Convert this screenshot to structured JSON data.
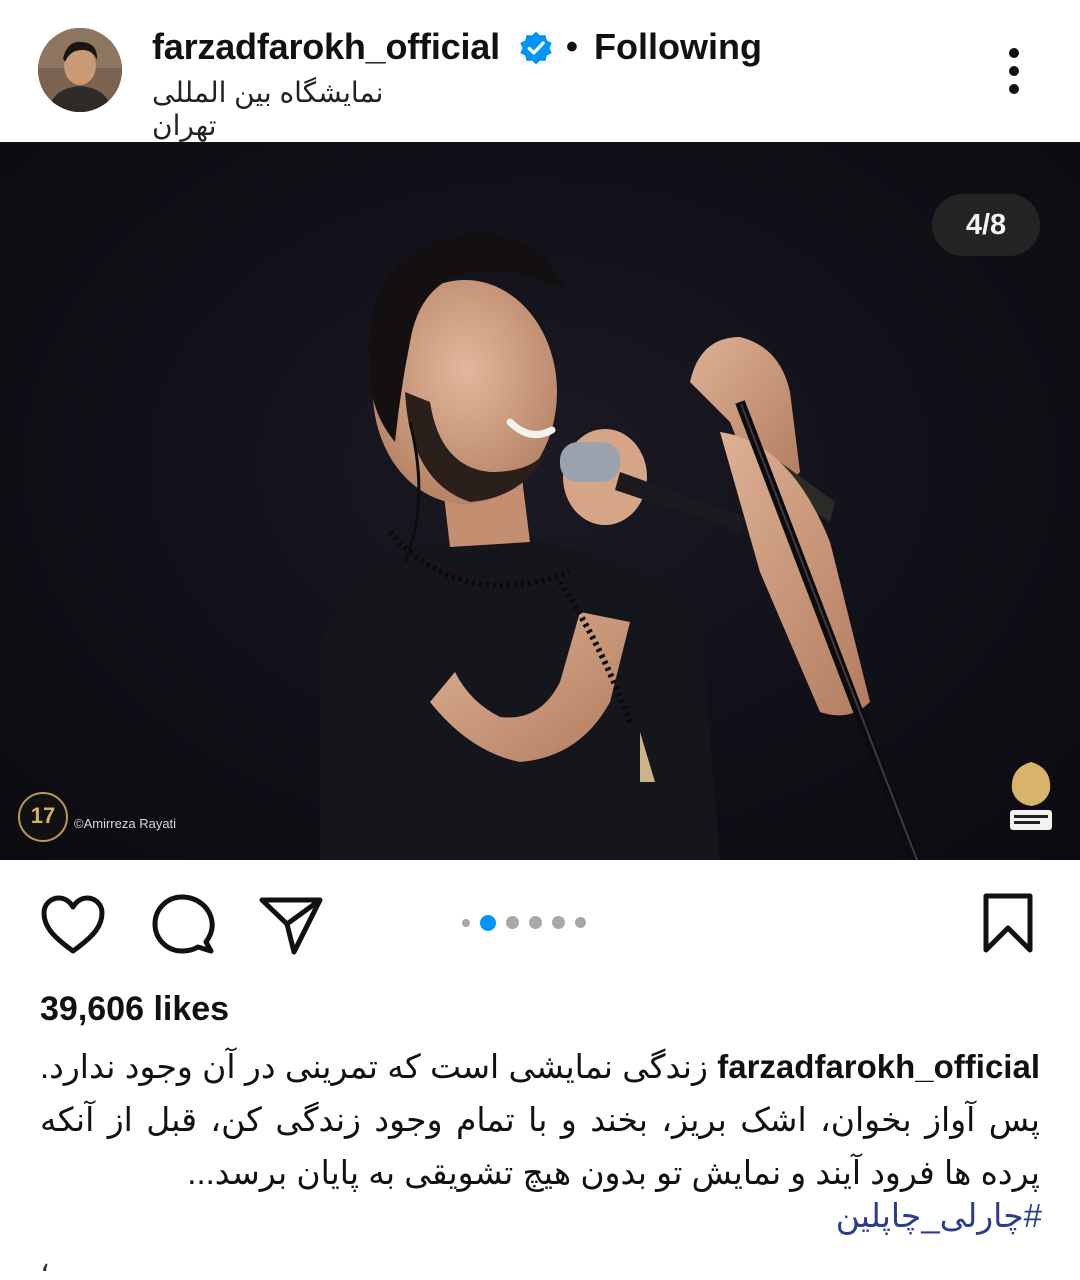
{
  "post": {
    "username": "farzadfarokh_official",
    "separator": "•",
    "follow_status": "Following",
    "location": "نمایشگاه بین المللی تهران"
  },
  "media": {
    "counter": "4/8",
    "photo_credit": "©Amirreza Rayati",
    "badge_text": "17",
    "current_index": 4,
    "total": 8
  },
  "engagement": {
    "likes": "39,606 likes"
  },
  "caption": {
    "username": "farzadfarokh_official",
    "text": "زندگی نمایشی است که تمرینی در آن وجود ندارد. پس آواز بخوان، اشک بریز، بخند و با تمام وجود زندگی کن، قبل از آنکه پرده ها فرود آیند و نمایش تو بدون هیچ تشویقی به پایان برسد...",
    "hashtag": "#چارلی_چاپلین",
    "trailing": "،"
  },
  "icons": {
    "like": "heart-icon",
    "comment": "comment-icon",
    "share": "send-icon",
    "save": "bookmark-icon",
    "more": "more-vertical-icon",
    "verified": "verified-badge-icon"
  },
  "colors": {
    "verified_blue": "#0095f6",
    "active_dot": "#0095f6",
    "hashtag": "#2b3d8f"
  }
}
